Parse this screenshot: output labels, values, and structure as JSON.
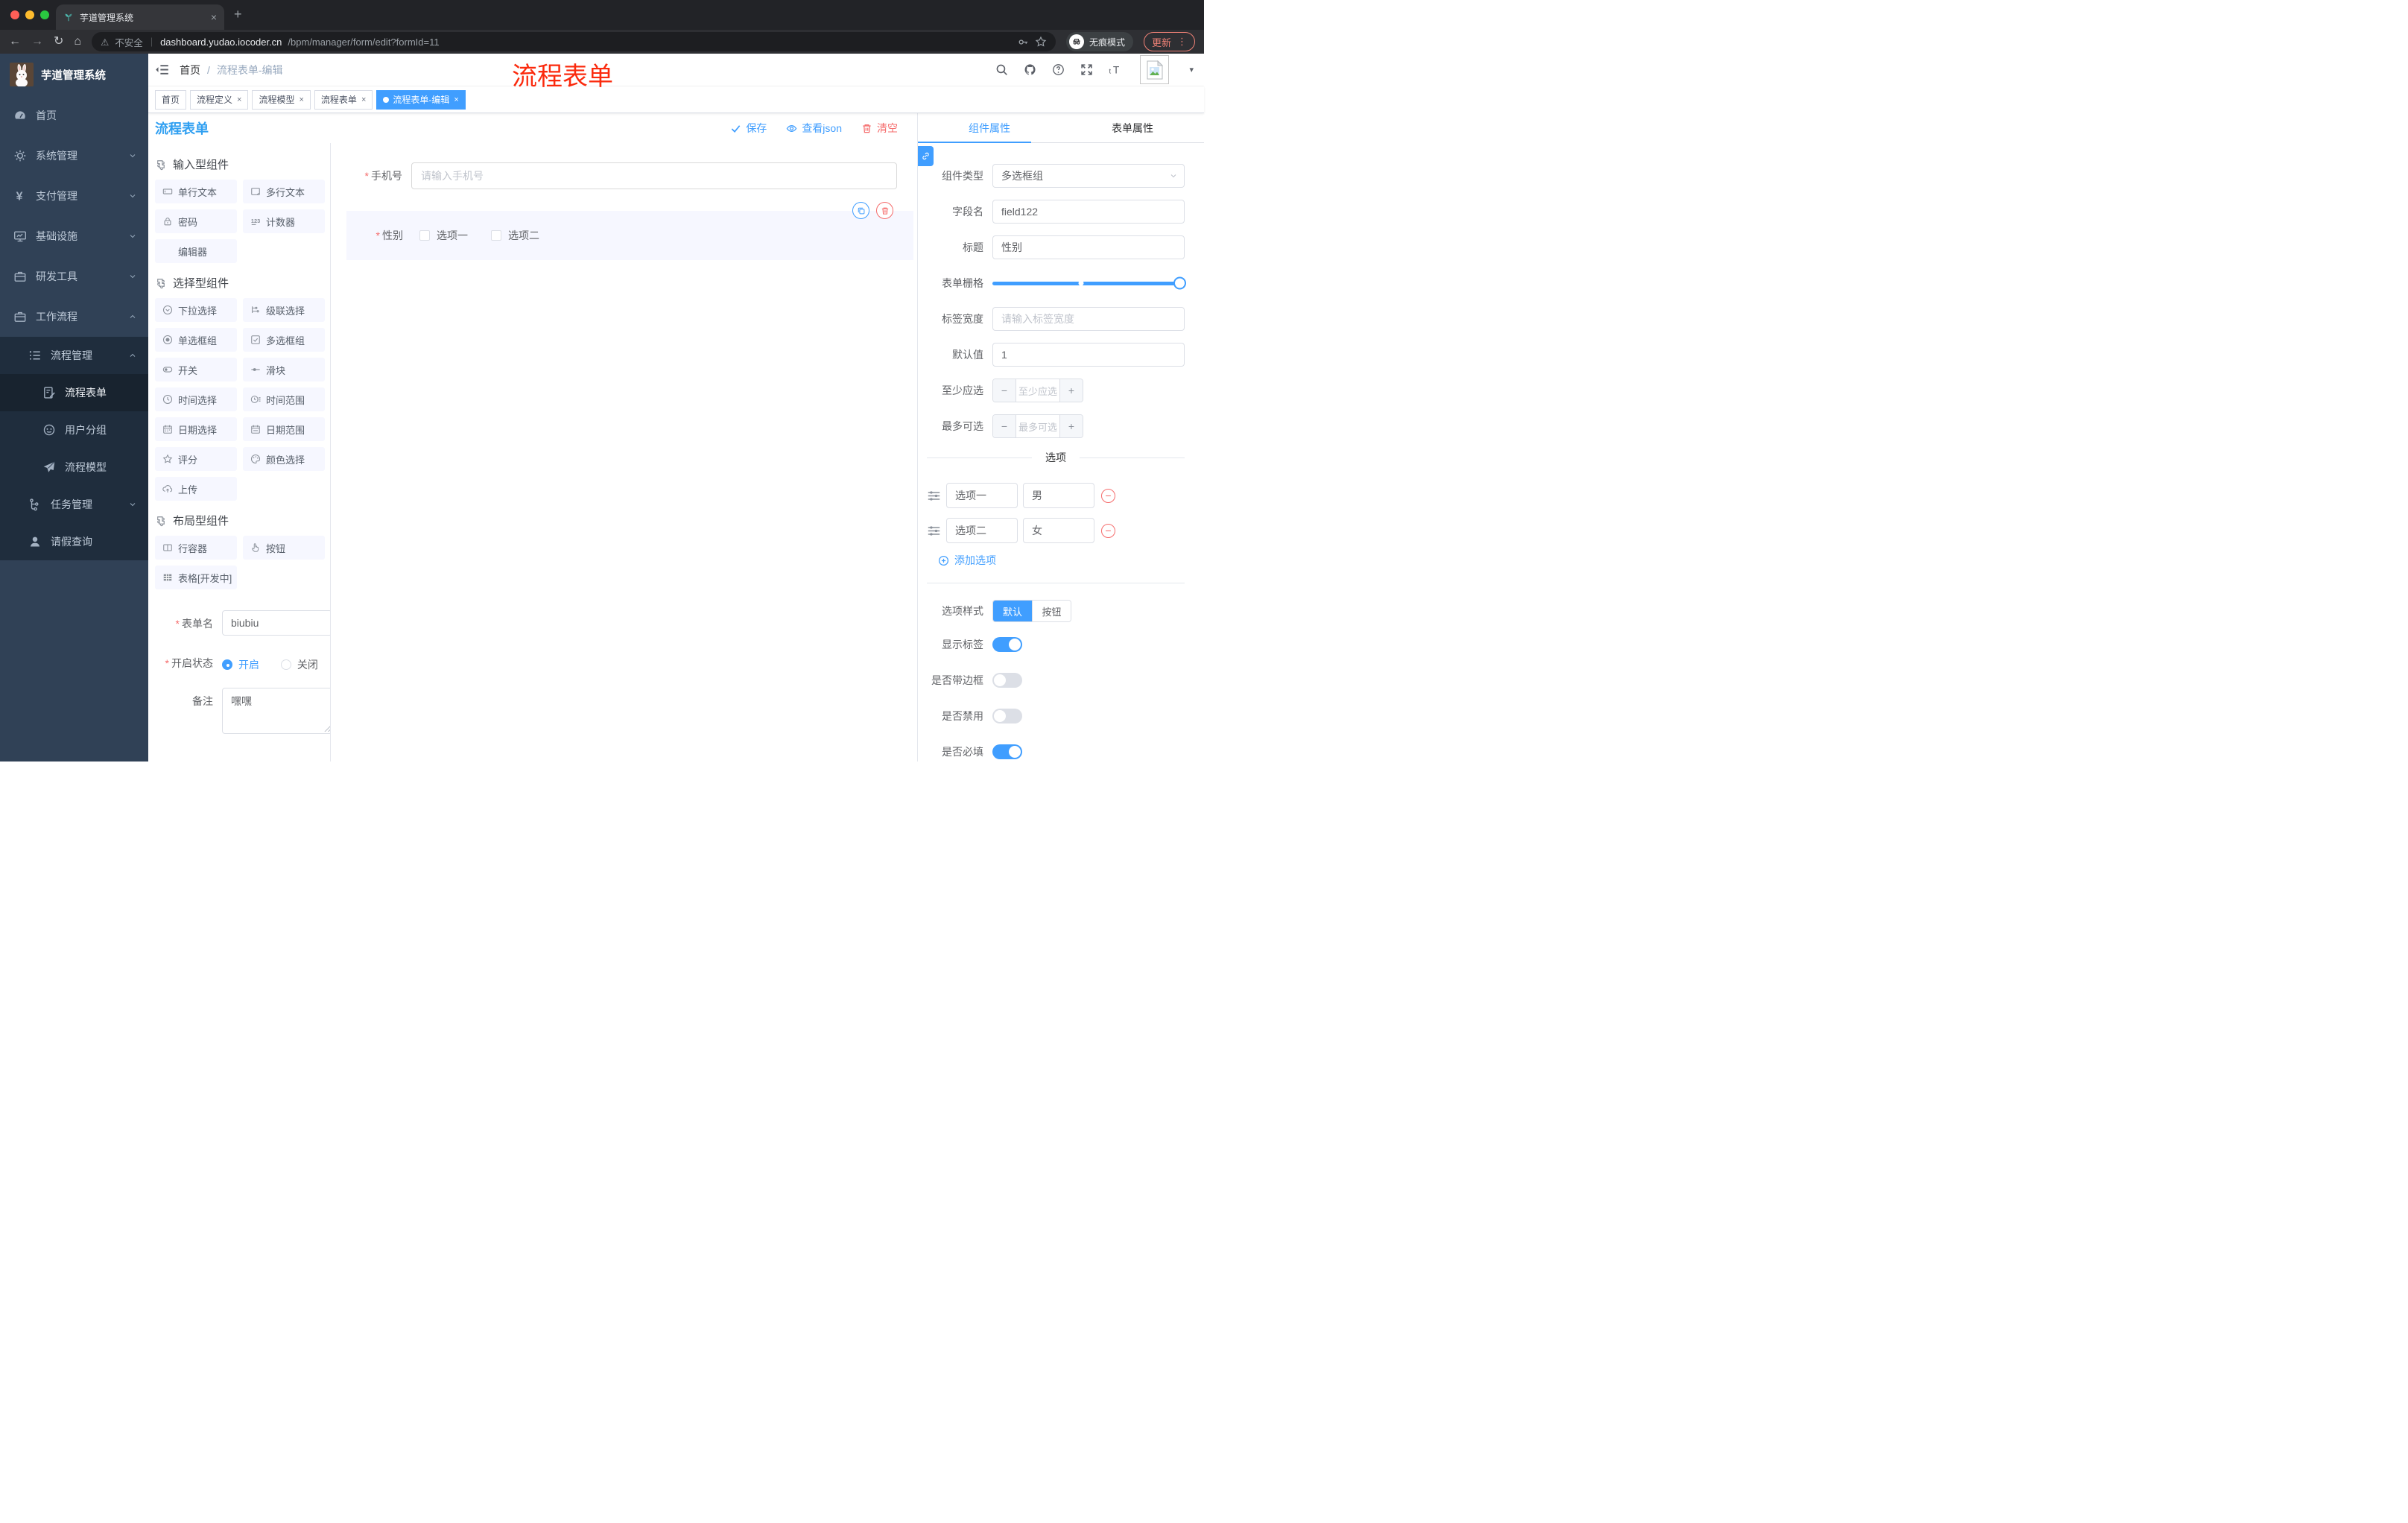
{
  "glyphs": {
    "required": "*",
    "close": "×",
    "plus": "+",
    "minus": "−",
    "caret": "▾",
    "warn": "⚠",
    "dots": "⋮",
    "back": "←",
    "forward": "→",
    "reload": "↻",
    "home": "⌂"
  },
  "browser": {
    "tab_title": "芋道管理系统",
    "security_label": "不安全",
    "url_host": "dashboard.yudao.iocoder.cn",
    "url_path": "/bpm/manager/form/edit?formId=11",
    "incognito_label": "无痕模式",
    "update_label": "更新"
  },
  "sidebar": {
    "logo_title": "芋道管理系统",
    "items": [
      {
        "label": "首页"
      },
      {
        "label": "系统管理"
      },
      {
        "label": "支付管理"
      },
      {
        "label": "基础设施"
      },
      {
        "label": "研发工具"
      },
      {
        "label": "工作流程"
      },
      {
        "label": "流程管理"
      },
      {
        "label": "流程表单"
      },
      {
        "label": "用户分组"
      },
      {
        "label": "流程模型"
      },
      {
        "label": "任务管理"
      },
      {
        "label": "请假查询"
      }
    ]
  },
  "header": {
    "breadcrumb": {
      "items": [
        "首页",
        "流程表单-编辑"
      ],
      "separator": "/"
    },
    "annotation": "流程表单"
  },
  "tags": {
    "items": [
      {
        "label": "首页"
      },
      {
        "label": "流程定义"
      },
      {
        "label": "流程模型"
      },
      {
        "label": "流程表单"
      },
      {
        "label": "流程表单-编辑"
      }
    ]
  },
  "designer": {
    "title": "流程表单",
    "actions": {
      "save": "保存",
      "view_json": "查看json",
      "clear": "清空"
    },
    "palette": {
      "sections": [
        {
          "title": "输入型组件",
          "items": [
            {
              "icon": "input-icon",
              "label": "单行文本"
            },
            {
              "icon": "textarea-icon",
              "label": "多行文本"
            },
            {
              "icon": "lock-icon",
              "label": "密码"
            },
            {
              "icon": "counter-icon",
              "label": "计数器"
            },
            {
              "icon": "none",
              "label": "编辑器"
            }
          ]
        },
        {
          "title": "选择型组件",
          "items": [
            {
              "icon": "select-icon",
              "label": "下拉选择"
            },
            {
              "icon": "cascader-icon",
              "label": "级联选择"
            },
            {
              "icon": "radio-icon",
              "label": "单选框组"
            },
            {
              "icon": "checkbox-icon",
              "label": "多选框组"
            },
            {
              "icon": "switch-icon",
              "label": "开关"
            },
            {
              "icon": "slider-icon",
              "label": "滑块"
            },
            {
              "icon": "time-icon",
              "label": "时间选择"
            },
            {
              "icon": "time-range-icon",
              "label": "时间范围"
            },
            {
              "icon": "date-icon",
              "label": "日期选择"
            },
            {
              "icon": "date-range-icon",
              "label": "日期范围"
            },
            {
              "icon": "star-icon",
              "label": "评分"
            },
            {
              "icon": "color-icon",
              "label": "颜色选择"
            },
            {
              "icon": "upload-icon",
              "label": "上传"
            }
          ]
        },
        {
          "title": "布局型组件",
          "items": [
            {
              "icon": "row-icon",
              "label": "行容器"
            },
            {
              "icon": "hand-icon",
              "label": "按钮"
            },
            {
              "icon": "table-icon",
              "label": "表格[开发中]"
            }
          ]
        }
      ]
    },
    "canvas": {
      "phone": {
        "label": "手机号",
        "placeholder": "请输入手机号"
      },
      "gender": {
        "label": "性别",
        "options": [
          "选项一",
          "选项二"
        ]
      }
    },
    "meta": {
      "form_name": {
        "label": "表单名",
        "value": "biubiu"
      },
      "status": {
        "label": "开启状态",
        "options": [
          "开启",
          "关闭"
        ],
        "selected": "开启"
      },
      "remark": {
        "label": "备注",
        "value": "嘿嘿"
      }
    }
  },
  "props": {
    "tabs": [
      {
        "label": "组件属性"
      },
      {
        "label": "表单属性"
      }
    ],
    "active_tab": "组件属性",
    "fields": {
      "component_type": {
        "label": "组件类型",
        "value": "多选框组"
      },
      "field_name": {
        "label": "字段名",
        "value": "field122"
      },
      "title": {
        "label": "标题",
        "value": "性别"
      },
      "grid": {
        "label": "表单栅格"
      },
      "label_width": {
        "label": "标签宽度",
        "placeholder": "请输入标签宽度"
      },
      "default_value": {
        "label": "默认值",
        "value": "1"
      },
      "min_select": {
        "label": "至少应选",
        "placeholder": "至少应选"
      },
      "max_select": {
        "label": "最多可选",
        "placeholder": "最多可选"
      }
    },
    "options": {
      "divider": "选项",
      "rows": [
        {
          "name": "选项一",
          "value": "男"
        },
        {
          "name": "选项二",
          "value": "女"
        }
      ],
      "add_label": "添加选项"
    },
    "style": {
      "option_style": {
        "label": "选项样式",
        "options": [
          "默认",
          "按钮"
        ],
        "selected": "默认"
      },
      "show_label": {
        "label": "显示标签",
        "on": true
      },
      "bordered": {
        "label": "是否带边框",
        "on": false
      },
      "disabled": {
        "label": "是否禁用",
        "on": false
      },
      "required": {
        "label": "是否必填",
        "on": true
      }
    }
  },
  "colors": {
    "accent": "#409eff",
    "danger": "#f56c6c",
    "designer_title": "#2f9ff1",
    "annotation": "#fb2a0d",
    "sidebar_bg": "#304156",
    "submenu_bg": "#1f2d3d",
    "chip_bg": "#f6f7ff",
    "tag_active": "#409eff",
    "toggle_on": "#409eff"
  }
}
